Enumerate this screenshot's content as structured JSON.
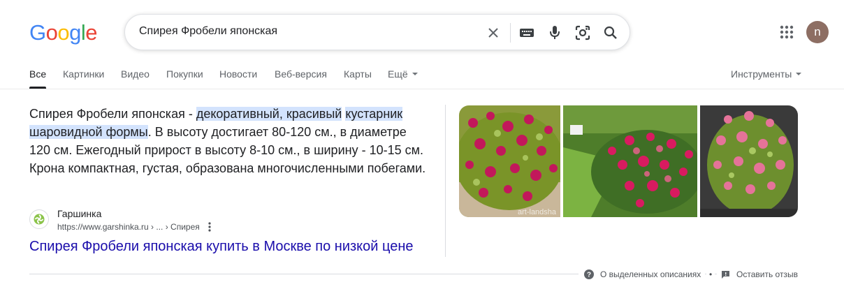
{
  "logo": {
    "letters": [
      "G",
      "o",
      "o",
      "g",
      "l",
      "e"
    ],
    "colors": [
      "#4285F4",
      "#EA4335",
      "#FBBC05",
      "#4285F4",
      "#34A853",
      "#EA4335"
    ]
  },
  "search": {
    "query": "Спирея Фробели японская",
    "icons": [
      "clear-icon",
      "keyboard-icon",
      "mic-icon",
      "lens-icon",
      "search-icon"
    ]
  },
  "account": {
    "avatar_letter": "n",
    "avatar_color": "#8d6e63"
  },
  "tabs": [
    {
      "label": "Все",
      "active": true
    },
    {
      "label": "Картинки"
    },
    {
      "label": "Видео"
    },
    {
      "label": "Покупки"
    },
    {
      "label": "Новости"
    },
    {
      "label": "Веб-версия"
    },
    {
      "label": "Карты"
    },
    {
      "label": "Ещё"
    }
  ],
  "tools_label": "Инструменты",
  "snippet": {
    "lead": "Спирея Фробели японская - ",
    "highlight_1": "декоративный, красивый",
    "highlight_2": "кустарник шаровидной формы",
    "rest": ". В высоту достигает 80-120 см., в диаметре 120 см. Ежегодный прирост в высоту 8-10 см., в ширину - 10-15 см. Крона компактная, густая, образована многочисленными побегами."
  },
  "source": {
    "name": "Гаршинка",
    "url": "https://www.garshinka.ru › ... › Спирея",
    "link_title": "Спирея Фробели японская купить в Москве по низкой цене"
  },
  "images": {
    "watermark": "art-landsha",
    "colors": {
      "foliage": "#6f8f2a",
      "flowers": "#c2185b",
      "lawn": "#7cb342"
    }
  },
  "footer": {
    "about_label": "О выделенных описаниях",
    "separator": "•",
    "feedback_label": "Оставить отзыв"
  }
}
